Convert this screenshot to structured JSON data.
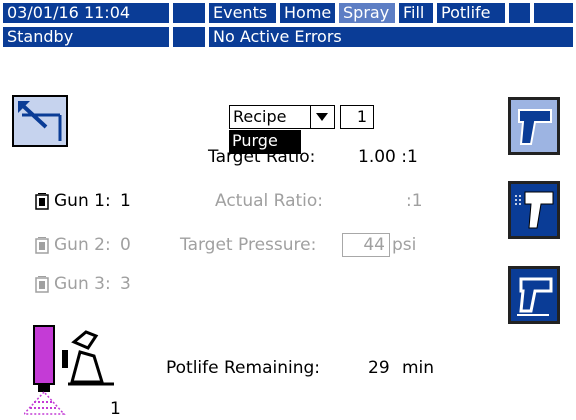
{
  "header": {
    "datetime": "03/01/16 11:04",
    "tabs": [
      {
        "label": "Events",
        "active": false
      },
      {
        "label": "Home",
        "active": false
      },
      {
        "label": "Spray",
        "active": true
      },
      {
        "label": "Fill",
        "active": false
      },
      {
        "label": "Potlife",
        "active": false
      }
    ],
    "status": "Standby",
    "error_message": "No Active Errors"
  },
  "recipe": {
    "selected": "Recipe",
    "number": "1",
    "dropdown_option": "Purge"
  },
  "ratios": {
    "target_ratio_label": "Target Ratio:",
    "target_ratio_value": "1.00 :1",
    "actual_ratio_label": "Actual Ratio:",
    "actual_ratio_value": ":1",
    "target_pressure_label": "Target Pressure:",
    "target_pressure_value": "44",
    "pressure_unit": "psi"
  },
  "guns": [
    {
      "label": "Gun 1:",
      "value": "1",
      "enabled": true
    },
    {
      "label": "Gun 2:",
      "value": "0",
      "enabled": false
    },
    {
      "label": "Gun 3:",
      "value": "3",
      "enabled": false
    }
  ],
  "potlife": {
    "label": "Potlife Remaining:",
    "value": "29",
    "unit": "min"
  },
  "mixer": {
    "count": "1"
  },
  "colors": {
    "accent": "#0a3c96",
    "active_tab": "#5d7ec4",
    "spray_pattern": "#c43bd6",
    "dim_text": "#a0a0a0"
  }
}
